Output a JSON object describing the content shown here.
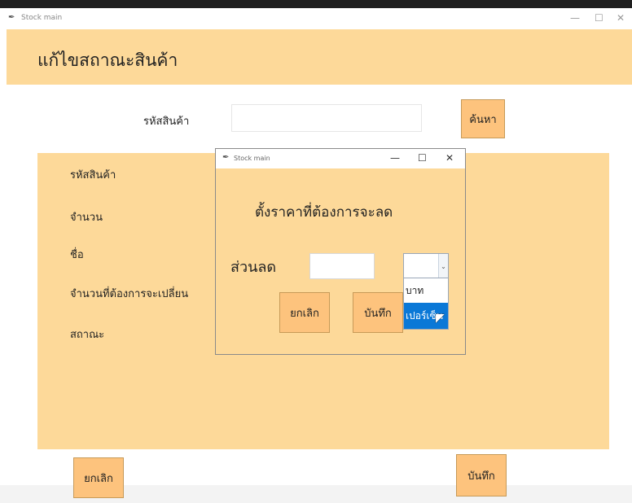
{
  "window": {
    "title": "Stock main",
    "minimize_glyph": "—",
    "maximize_glyph": "☐",
    "close_glyph": "✕"
  },
  "header": {
    "title": "แก้ไขสถาณะสินค้า"
  },
  "search": {
    "label": "รหัสสินค้า",
    "value": "",
    "button_label": "ค้นหา"
  },
  "form": {
    "fields": [
      {
        "label": "รหัสสินค้า"
      },
      {
        "label": "จำนวน"
      },
      {
        "label": "ชื่อ"
      },
      {
        "label": "จำนวนที่ต้องการจะเปลี่ยน"
      },
      {
        "label": "สถาณะ"
      }
    ]
  },
  "dialog": {
    "title": "Stock main",
    "minimize_glyph": "—",
    "maximize_glyph": "☐",
    "close_glyph": "✕",
    "heading": "ตั้งราคาที่ต้องการจะลด",
    "discount_label": "ส่วนลด",
    "discount_value": "",
    "unit_selected": "",
    "unit_options": [
      "บาท",
      "เปอร์เซ็น"
    ],
    "highlighted_option": 1,
    "cancel_label": "ยกเลิก",
    "save_label": "บันทึก"
  },
  "footer": {
    "cancel_label": "ยกเลิก",
    "save_label": "บันทึก"
  },
  "colors": {
    "panel": "#fdd999",
    "button": "#fdc37d",
    "selection": "#0a78d7"
  },
  "icons": {
    "app": "feather-icon",
    "dropdown": "chevron-down-icon",
    "pointer": "mouse-pointer-icon"
  }
}
